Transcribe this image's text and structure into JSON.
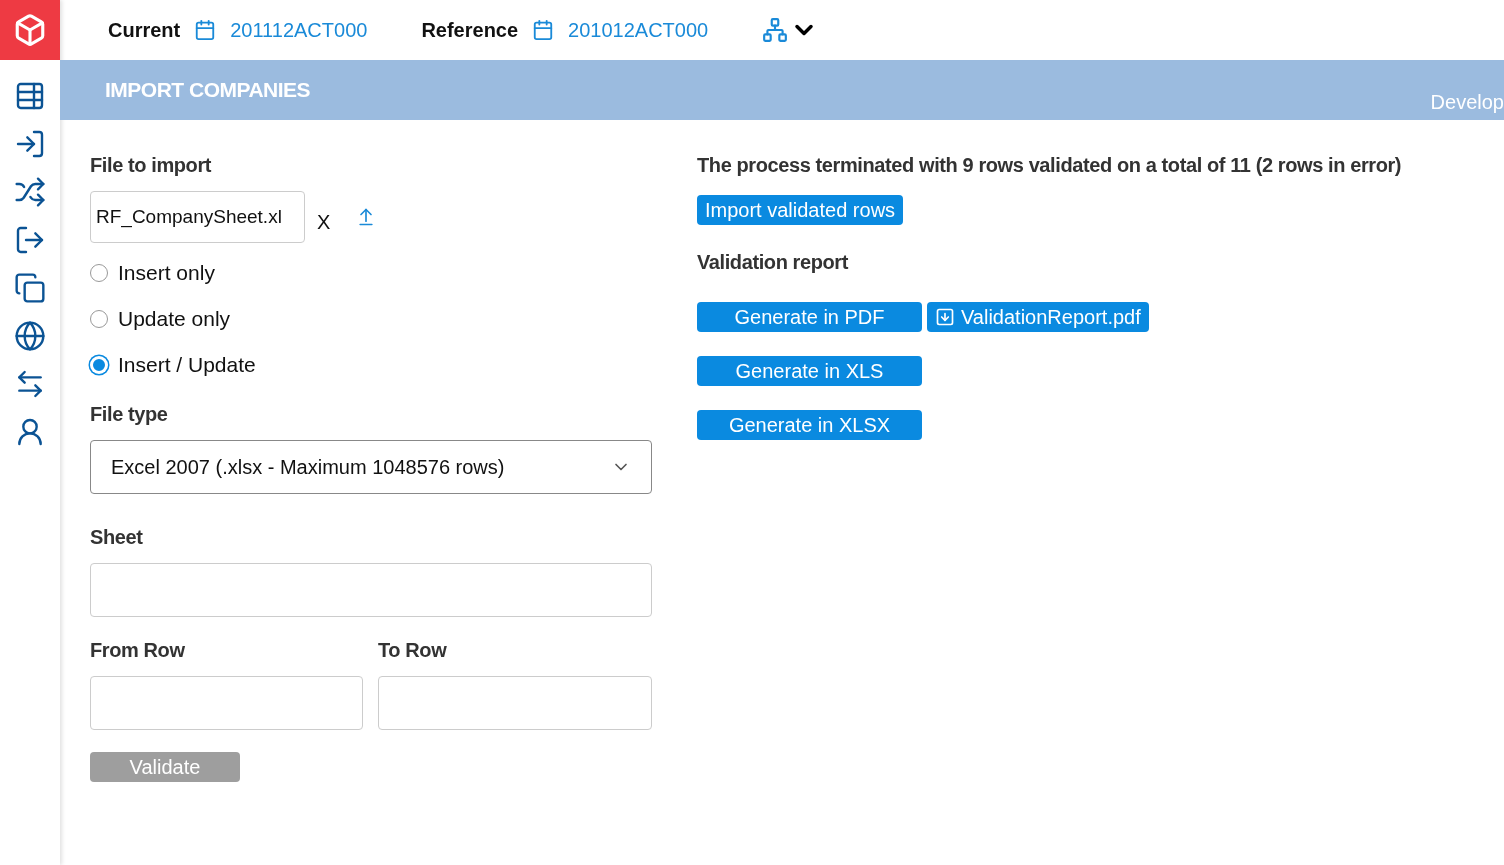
{
  "topbar": {
    "current": {
      "label": "Current",
      "value": "201112ACT000"
    },
    "reference": {
      "label": "Reference",
      "value": "201012ACT000"
    }
  },
  "header": {
    "title": "IMPORT COMPANIES",
    "right_text": "Develop"
  },
  "form": {
    "file_label": "File to import",
    "file_value": "RF_CompanySheet.xl",
    "clear": "X",
    "modes": [
      {
        "label": "Insert only",
        "selected": false
      },
      {
        "label": "Update only",
        "selected": false
      },
      {
        "label": "Insert / Update",
        "selected": true
      }
    ],
    "file_type_label": "File type",
    "file_type_value": "Excel 2007 (.xlsx - Maximum 1048576 rows)",
    "sheet_label": "Sheet",
    "from_row_label": "From Row",
    "to_row_label": "To Row",
    "validate": {
      "label": "Validate",
      "disabled": true
    }
  },
  "result": {
    "message": "The process terminated with 9 rows validated on a total of 11 (2 rows in error)",
    "import_button": "Import validated rows",
    "report_label": "Validation report",
    "generate_buttons": [
      {
        "label": "Generate in PDF",
        "file": "ValidationReport.pdf"
      },
      {
        "label": "Generate in XLS"
      },
      {
        "label": "Generate in XLSX"
      }
    ]
  }
}
